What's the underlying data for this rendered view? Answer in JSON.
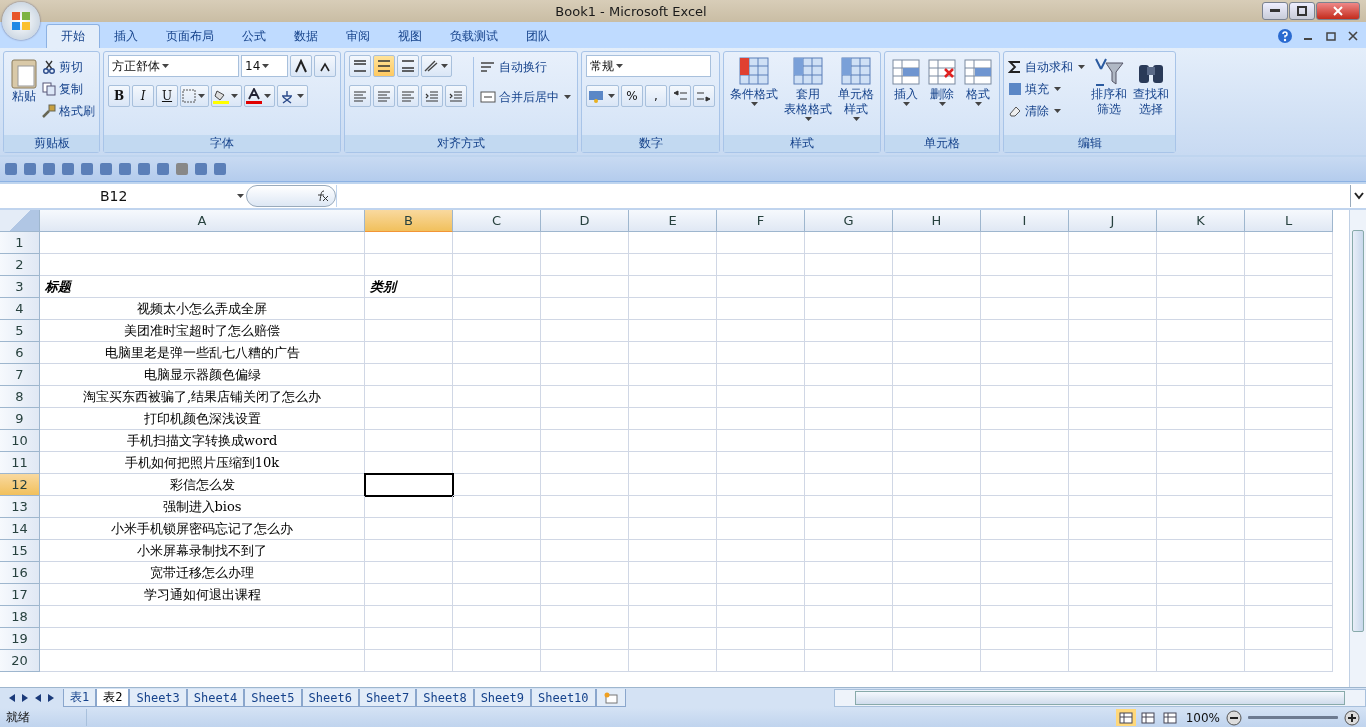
{
  "window": {
    "title": "Book1 - Microsoft Excel"
  },
  "ribbon_tabs": [
    {
      "label": "开始",
      "selected": true
    },
    {
      "label": "插入",
      "selected": false
    },
    {
      "label": "页面布局",
      "selected": false
    },
    {
      "label": "公式",
      "selected": false
    },
    {
      "label": "数据",
      "selected": false
    },
    {
      "label": "审阅",
      "selected": false
    },
    {
      "label": "视图",
      "selected": false
    },
    {
      "label": "负载测试",
      "selected": false
    },
    {
      "label": "团队",
      "selected": false
    }
  ],
  "clipboard": {
    "paste": "粘贴",
    "items": [
      "剪切",
      "复制",
      "格式刷"
    ],
    "label": "剪贴板"
  },
  "font": {
    "name": "方正舒体",
    "size": "14",
    "styles": [
      "B",
      "I",
      "U"
    ],
    "label": "字体"
  },
  "alignment": {
    "wrap": "自动换行",
    "merge": "合并后居中",
    "label": "对齐方式"
  },
  "number": {
    "format": "常规",
    "symbols": [
      "%",
      ","
    ],
    "label": "数字"
  },
  "styles": {
    "buttons": [
      [
        "条件格式"
      ],
      [
        "套用",
        "表格格式"
      ],
      [
        "单元格",
        "样式"
      ]
    ],
    "label": "样式"
  },
  "cells": {
    "buttons": [
      "插入",
      "删除",
      "格式"
    ],
    "label": "单元格"
  },
  "editing": {
    "items": [
      "自动求和",
      "填充",
      "清除"
    ],
    "buttons": [
      [
        "排序和",
        "筛选"
      ],
      [
        "查找和",
        "选择"
      ]
    ],
    "label": "编辑"
  },
  "name_box": "B12",
  "columns": [
    {
      "label": "A",
      "selected": false
    },
    {
      "label": "B",
      "selected": true
    },
    {
      "label": "C",
      "selected": false
    },
    {
      "label": "D",
      "selected": false
    },
    {
      "label": "E",
      "selected": false
    },
    {
      "label": "F",
      "selected": false
    },
    {
      "label": "G",
      "selected": false
    },
    {
      "label": "H",
      "selected": false
    },
    {
      "label": "I",
      "selected": false
    },
    {
      "label": "J",
      "selected": false
    },
    {
      "label": "K",
      "selected": false
    },
    {
      "label": "L",
      "selected": false
    }
  ],
  "rows": [
    {
      "number": "1",
      "selected": false
    },
    {
      "number": "2",
      "selected": false
    },
    {
      "number": "3",
      "selected": false,
      "kind": "heading",
      "a": "标题",
      "b": "类别"
    },
    {
      "number": "4",
      "selected": false,
      "kind": "entry",
      "a": "视频太小怎么弄成全屏"
    },
    {
      "number": "5",
      "selected": false,
      "kind": "entry",
      "a": "美团准时宝超时了怎么赔偿"
    },
    {
      "number": "6",
      "selected": false,
      "kind": "entry",
      "a": "电脑里老是弹一些乱七八糟的广告"
    },
    {
      "number": "7",
      "selected": false,
      "kind": "entry",
      "a": "电脑显示器颜色偏绿"
    },
    {
      "number": "8",
      "selected": false,
      "kind": "entry",
      "a": "淘宝买东西被骗了,结果店铺关闭了怎么办"
    },
    {
      "number": "9",
      "selected": false,
      "kind": "entry",
      "a": "打印机颜色深浅设置"
    },
    {
      "number": "10",
      "selected": false,
      "kind": "entry",
      "a": "手机扫描文字转换成word"
    },
    {
      "number": "11",
      "selected": false,
      "kind": "entry",
      "a": "手机如何把照片压缩到10k"
    },
    {
      "number": "12",
      "selected": true,
      "kind": "entry",
      "a": "彩信怎么发"
    },
    {
      "number": "13",
      "selected": false,
      "kind": "entry",
      "a": "强制进入bios"
    },
    {
      "number": "14",
      "selected": false,
      "kind": "entry",
      "a": "小米手机锁屏密码忘记了怎么办"
    },
    {
      "number": "15",
      "selected": false,
      "kind": "entry",
      "a": "小米屏幕录制找不到了"
    },
    {
      "number": "16",
      "selected": false,
      "kind": "entry",
      "a": "宽带迁移怎么办理"
    },
    {
      "number": "17",
      "selected": false,
      "kind": "entry",
      "a": "学习通如何退出课程"
    },
    {
      "number": "18",
      "selected": false
    },
    {
      "number": "19",
      "selected": false
    },
    {
      "number": "20",
      "selected": false
    }
  ],
  "sheets": [
    {
      "label": "表1",
      "selected": false
    },
    {
      "label": "表2",
      "selected": true
    },
    {
      "label": "Sheet3",
      "selected": false
    },
    {
      "label": "Sheet4",
      "selected": false
    },
    {
      "label": "Sheet5",
      "selected": false
    },
    {
      "label": "Sheet6",
      "selected": false
    },
    {
      "label": "Sheet7",
      "selected": false
    },
    {
      "label": "Sheet8",
      "selected": false
    },
    {
      "label": "Sheet9",
      "selected": false
    },
    {
      "label": "Sheet10",
      "selected": false
    }
  ],
  "status_bar": {
    "text": "就绪",
    "zoom": "100%"
  }
}
